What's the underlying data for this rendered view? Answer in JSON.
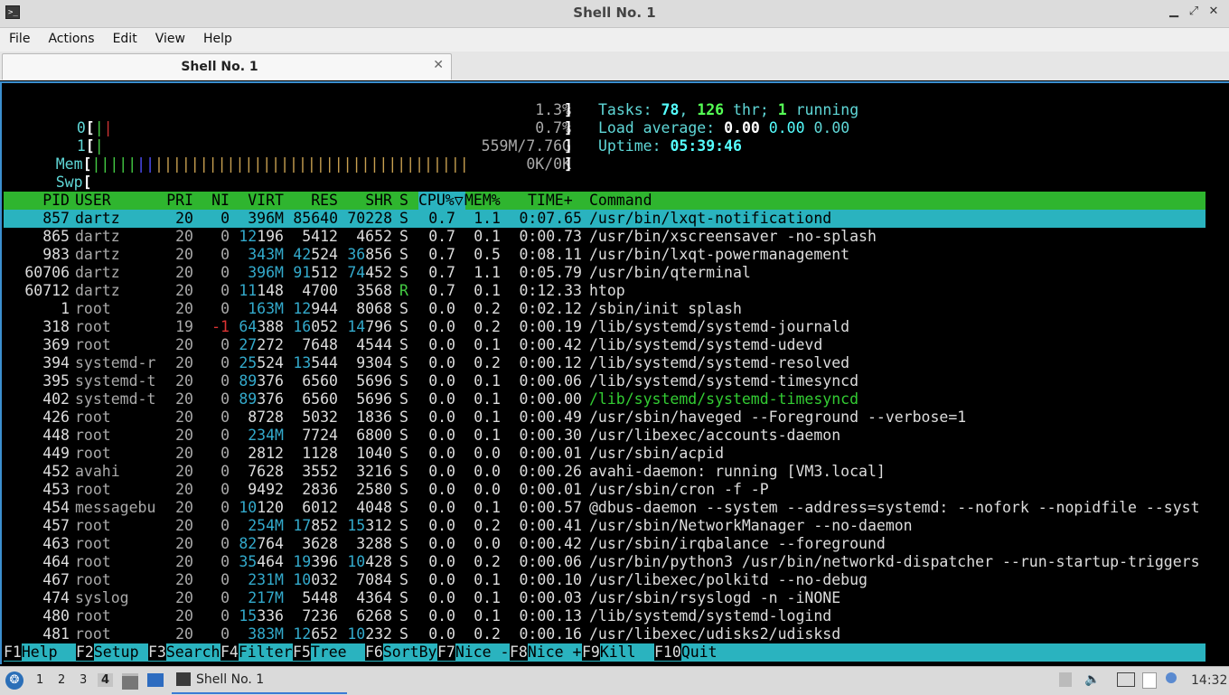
{
  "window": {
    "title": "Shell No. 1",
    "controls": [
      "minimize-icon",
      "maximize-icon",
      "close-icon"
    ]
  },
  "menu": [
    "File",
    "Actions",
    "Edit",
    "View",
    "Help"
  ],
  "tab": {
    "label": "Shell No. 1",
    "close": "✕"
  },
  "meters": {
    "cpu0": {
      "label": "0",
      "value": "1.3%"
    },
    "cpu1": {
      "label": "1",
      "value": "0.7%"
    },
    "mem": {
      "label": "Mem",
      "value": "559M/7.76G"
    },
    "swp": {
      "label": "Swp",
      "value": "0K/0K"
    }
  },
  "summary": {
    "tasks_label": "Tasks: ",
    "tasks": "78",
    "thr": "126",
    "thr_label": " thr; ",
    "running": "1",
    "running_label": " running",
    "load_label": "Load average: ",
    "load1": "0.00",
    "load5": "0.00",
    "load15": "0.00",
    "uptime_label": "Uptime: ",
    "uptime": "05:39:46"
  },
  "columns": [
    "PID",
    "USER",
    "PRI",
    "NI",
    "VIRT",
    "RES",
    "SHR",
    "S",
    "CPU%▽",
    "MEM%",
    "TIME+",
    "Command"
  ],
  "processes": [
    [
      "857",
      "dartz",
      "20",
      "0",
      "396M",
      "85640",
      "70228",
      "S",
      "0.7",
      "1.1",
      "0:07.65",
      "/usr/bin/lxqt-notificationd"
    ],
    [
      "865",
      "dartz",
      "20",
      "0",
      "12196",
      "5412",
      "4652",
      "S",
      "0.7",
      "0.1",
      "0:00.73",
      "/usr/bin/xscreensaver -no-splash"
    ],
    [
      "983",
      "dartz",
      "20",
      "0",
      "343M",
      "42524",
      "36856",
      "S",
      "0.7",
      "0.5",
      "0:08.11",
      "/usr/bin/lxqt-powermanagement"
    ],
    [
      "60706",
      "dartz",
      "20",
      "0",
      "396M",
      "91512",
      "74452",
      "S",
      "0.7",
      "1.1",
      "0:05.79",
      "/usr/bin/qterminal"
    ],
    [
      "60712",
      "dartz",
      "20",
      "0",
      "11148",
      "4700",
      "3568",
      "R",
      "0.7",
      "0.1",
      "0:12.33",
      "htop"
    ],
    [
      "1",
      "root",
      "20",
      "0",
      "163M",
      "12944",
      "8068",
      "S",
      "0.0",
      "0.2",
      "0:02.12",
      "/sbin/init splash"
    ],
    [
      "318",
      "root",
      "19",
      "-1",
      "64388",
      "16052",
      "14796",
      "S",
      "0.0",
      "0.2",
      "0:00.19",
      "/lib/systemd/systemd-journald"
    ],
    [
      "369",
      "root",
      "20",
      "0",
      "27272",
      "7648",
      "4544",
      "S",
      "0.0",
      "0.1",
      "0:00.42",
      "/lib/systemd/systemd-udevd"
    ],
    [
      "394",
      "systemd-r",
      "20",
      "0",
      "25524",
      "13544",
      "9304",
      "S",
      "0.0",
      "0.2",
      "0:00.12",
      "/lib/systemd/systemd-resolved"
    ],
    [
      "395",
      "systemd-t",
      "20",
      "0",
      "89376",
      "6560",
      "5696",
      "S",
      "0.0",
      "0.1",
      "0:00.06",
      "/lib/systemd/systemd-timesyncd"
    ],
    [
      "402",
      "systemd-t",
      "20",
      "0",
      "89376",
      "6560",
      "5696",
      "S",
      "0.0",
      "0.1",
      "0:00.00",
      "/lib/systemd/systemd-timesyncd"
    ],
    [
      "426",
      "root",
      "20",
      "0",
      "8728",
      "5032",
      "1836",
      "S",
      "0.0",
      "0.1",
      "0:00.49",
      "/usr/sbin/haveged --Foreground --verbose=1"
    ],
    [
      "448",
      "root",
      "20",
      "0",
      "234M",
      "7724",
      "6800",
      "S",
      "0.0",
      "0.1",
      "0:00.30",
      "/usr/libexec/accounts-daemon"
    ],
    [
      "449",
      "root",
      "20",
      "0",
      "2812",
      "1128",
      "1040",
      "S",
      "0.0",
      "0.0",
      "0:00.01",
      "/usr/sbin/acpid"
    ],
    [
      "452",
      "avahi",
      "20",
      "0",
      "7628",
      "3552",
      "3216",
      "S",
      "0.0",
      "0.0",
      "0:00.26",
      "avahi-daemon: running [VM3.local]"
    ],
    [
      "453",
      "root",
      "20",
      "0",
      "9492",
      "2836",
      "2580",
      "S",
      "0.0",
      "0.0",
      "0:00.01",
      "/usr/sbin/cron -f -P"
    ],
    [
      "454",
      "messagebu",
      "20",
      "0",
      "10120",
      "6012",
      "4048",
      "S",
      "0.0",
      "0.1",
      "0:00.57",
      "@dbus-daemon --system --address=systemd: --nofork --nopidfile --syst"
    ],
    [
      "457",
      "root",
      "20",
      "0",
      "254M",
      "17852",
      "15312",
      "S",
      "0.0",
      "0.2",
      "0:00.41",
      "/usr/sbin/NetworkManager --no-daemon"
    ],
    [
      "463",
      "root",
      "20",
      "0",
      "82764",
      "3628",
      "3288",
      "S",
      "0.0",
      "0.0",
      "0:00.42",
      "/usr/sbin/irqbalance --foreground"
    ],
    [
      "464",
      "root",
      "20",
      "0",
      "35464",
      "19396",
      "10428",
      "S",
      "0.0",
      "0.2",
      "0:00.06",
      "/usr/bin/python3 /usr/bin/networkd-dispatcher --run-startup-triggers"
    ],
    [
      "467",
      "root",
      "20",
      "0",
      "231M",
      "10032",
      "7084",
      "S",
      "0.0",
      "0.1",
      "0:00.10",
      "/usr/libexec/polkitd --no-debug"
    ],
    [
      "474",
      "syslog",
      "20",
      "0",
      "217M",
      "5448",
      "4364",
      "S",
      "0.0",
      "0.1",
      "0:00.03",
      "/usr/sbin/rsyslogd -n -iNONE"
    ],
    [
      "480",
      "root",
      "20",
      "0",
      "15336",
      "7236",
      "6268",
      "S",
      "0.0",
      "0.1",
      "0:00.13",
      "/lib/systemd/systemd-logind"
    ],
    [
      "481",
      "root",
      "20",
      "0",
      "383M",
      "12652",
      "10232",
      "S",
      "0.0",
      "0.2",
      "0:00.16",
      "/usr/libexec/udisks2/udisksd"
    ]
  ],
  "fkeys": [
    {
      "key": "F1",
      "label": "Help  "
    },
    {
      "key": "F2",
      "label": "Setup "
    },
    {
      "key": "F3",
      "label": "Search"
    },
    {
      "key": "F4",
      "label": "Filter"
    },
    {
      "key": "F5",
      "label": "Tree  "
    },
    {
      "key": "F6",
      "label": "SortBy"
    },
    {
      "key": "F7",
      "label": "Nice -"
    },
    {
      "key": "F8",
      "label": "Nice +"
    },
    {
      "key": "F9",
      "label": "Kill  "
    },
    {
      "key": "F10",
      "label": "Quit"
    }
  ],
  "taskbar": {
    "workspaces": [
      "1",
      "2",
      "3",
      "4"
    ],
    "active_workspace": "4",
    "task_label": "Shell No. 1",
    "clock": "14:32"
  },
  "colors": {
    "header_bg": "#2fb52f",
    "selected_bg": "#2ab3bf",
    "accent": "#3c8fcf"
  }
}
